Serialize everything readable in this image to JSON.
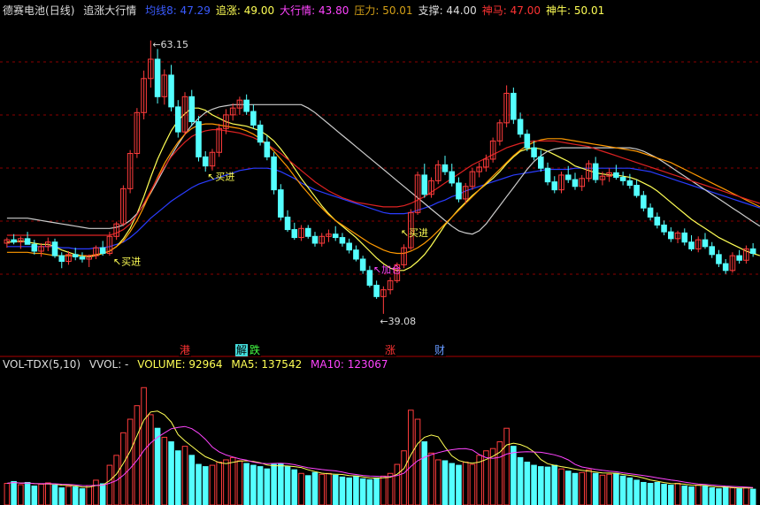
{
  "header": {
    "stock_name": "德赛电池",
    "period": "(日线)",
    "indicator_name": "追涨大行情",
    "items": [
      {
        "label": "均线8: ",
        "value": "47.29",
        "color": "#3a5bff"
      },
      {
        "label": "追涨: ",
        "value": "49.00",
        "color": "#ffff55"
      },
      {
        "label": "大行情: ",
        "value": "43.80",
        "color": "#ff44ff"
      },
      {
        "label": "压力: ",
        "value": "50.01",
        "color": "#d4a017"
      },
      {
        "label": "支撑: ",
        "value": "44.00",
        "color": "#dddddd"
      },
      {
        "label": "神马: ",
        "value": "47.00",
        "color": "#ff3333"
      },
      {
        "label": "神牛: ",
        "value": "50.01",
        "color": "#ffff55"
      }
    ]
  },
  "annotations": {
    "high_label": "63.15",
    "low_label": "39.08",
    "buy1": "买进",
    "buy2": "买进",
    "buy3": "买进",
    "add": "加仓"
  },
  "badges": [
    {
      "text": "港",
      "color": "#ff3333",
      "bg": "#000000"
    },
    {
      "text": "解",
      "color": "#000000",
      "bg": "#44dddd"
    },
    {
      "text": "跌",
      "color": "#44ff44",
      "bg": "#000000"
    },
    {
      "text": "涨",
      "color": "#ff3333",
      "bg": "#000000"
    },
    {
      "text": "财",
      "color": "#6699ff",
      "bg": "#000000"
    }
  ],
  "volume_header": {
    "name": "VOL-TDX(5,10)",
    "vvol": "VVOL: -",
    "volume_label": "VOLUME: ",
    "volume_value": "92964",
    "ma5_label": "MA5: ",
    "ma5_value": "137542",
    "ma10_label": "MA10: ",
    "ma10_value": "123067"
  },
  "colors": {
    "up": "#ff3c3c",
    "down": "#54ffff",
    "grid": "#8b0000",
    "ma_blue": "#2a3cff",
    "ma_yellow": "#ffff55",
    "ma_white": "#cccccc",
    "ma_orange": "#ff9900",
    "ma_red": "#dd2222",
    "vol_ma5": "#ffff55",
    "vol_ma10": "#ff44ff"
  },
  "chart_data": {
    "type": "candlestick",
    "price_range": [
      36.5,
      65.0
    ],
    "high": 63.15,
    "low": 39.08,
    "candles": [
      [
        45.3,
        45.8,
        44.9,
        45.6
      ],
      [
        45.6,
        46.1,
        45.2,
        45.4
      ],
      [
        45.4,
        45.9,
        44.8,
        45.7
      ],
      [
        45.7,
        46.3,
        45.3,
        45.2
      ],
      [
        45.2,
        45.6,
        44.3,
        44.6
      ],
      [
        44.6,
        45.3,
        44.1,
        45.0
      ],
      [
        45.0,
        45.8,
        44.6,
        45.4
      ],
      [
        45.4,
        45.7,
        44.0,
        44.2
      ],
      [
        44.2,
        44.5,
        43.1,
        43.7
      ],
      [
        43.7,
        44.6,
        43.4,
        44.3
      ],
      [
        44.3,
        44.9,
        43.8,
        44.1
      ],
      [
        44.1,
        44.5,
        43.6,
        43.9
      ],
      [
        43.9,
        44.3,
        43.2,
        44.2
      ],
      [
        44.2,
        45.1,
        43.9,
        44.9
      ],
      [
        44.9,
        45.5,
        44.2,
        44.4
      ],
      [
        44.4,
        46.3,
        44.2,
        45.9
      ],
      [
        45.9,
        47.2,
        45.6,
        47.0
      ],
      [
        47.0,
        50.4,
        46.8,
        50.1
      ],
      [
        50.1,
        53.5,
        49.7,
        53.2
      ],
      [
        53.2,
        57.2,
        52.8,
        56.8
      ],
      [
        56.8,
        60.5,
        56.2,
        59.8
      ],
      [
        59.8,
        63.15,
        59.0,
        61.5
      ],
      [
        61.5,
        62.4,
        57.6,
        58.2
      ],
      [
        58.2,
        60.6,
        57.5,
        60.1
      ],
      [
        60.1,
        61.0,
        56.9,
        57.3
      ],
      [
        57.3,
        57.9,
        54.6,
        55.1
      ],
      [
        55.1,
        58.6,
        54.8,
        58.2
      ],
      [
        58.2,
        58.8,
        55.6,
        56.0
      ],
      [
        56.0,
        56.5,
        52.5,
        52.9
      ],
      [
        52.9,
        53.4,
        51.6,
        52.1
      ],
      [
        52.1,
        53.6,
        51.7,
        53.3
      ],
      [
        53.3,
        55.8,
        52.9,
        55.4
      ],
      [
        55.4,
        57.1,
        54.9,
        56.6
      ],
      [
        56.6,
        57.6,
        56.1,
        57.2
      ],
      [
        57.2,
        58.2,
        56.6,
        57.9
      ],
      [
        57.9,
        58.4,
        56.6,
        56.9
      ],
      [
        56.9,
        57.5,
        55.4,
        55.7
      ],
      [
        55.7,
        56.1,
        53.9,
        54.2
      ],
      [
        54.2,
        54.8,
        52.6,
        52.9
      ],
      [
        52.9,
        53.3,
        49.6,
        50.0
      ],
      [
        50.0,
        50.5,
        47.3,
        47.6
      ],
      [
        47.6,
        48.2,
        46.3,
        46.5
      ],
      [
        46.5,
        47.1,
        45.6,
        45.8
      ],
      [
        45.8,
        46.9,
        45.5,
        46.6
      ],
      [
        46.6,
        46.9,
        45.7,
        45.9
      ],
      [
        45.9,
        46.3,
        45.0,
        45.3
      ],
      [
        45.3,
        46.2,
        45.0,
        45.9
      ],
      [
        45.9,
        46.5,
        45.4,
        46.1
      ],
      [
        46.1,
        46.8,
        45.5,
        45.8
      ],
      [
        45.8,
        46.2,
        45.0,
        45.3
      ],
      [
        45.3,
        45.7,
        44.4,
        44.7
      ],
      [
        44.7,
        45.1,
        43.7,
        43.9
      ],
      [
        43.9,
        44.2,
        42.6,
        42.9
      ],
      [
        42.9,
        43.3,
        41.4,
        41.6
      ],
      [
        41.6,
        42.0,
        40.4,
        40.6
      ],
      [
        40.6,
        41.5,
        39.08,
        41.2
      ],
      [
        41.2,
        42.3,
        40.8,
        42.0
      ],
      [
        42.0,
        43.6,
        41.8,
        43.4
      ],
      [
        43.4,
        45.2,
        43.1,
        44.9
      ],
      [
        44.9,
        48.3,
        44.7,
        48.0
      ],
      [
        48.0,
        51.6,
        47.8,
        51.3
      ],
      [
        51.3,
        52.3,
        49.3,
        49.6
      ],
      [
        49.6,
        51.1,
        49.3,
        50.8
      ],
      [
        50.8,
        52.6,
        50.5,
        52.2
      ],
      [
        52.2,
        53.0,
        51.3,
        51.6
      ],
      [
        51.6,
        52.3,
        50.3,
        50.6
      ],
      [
        50.6,
        51.1,
        48.9,
        49.2
      ],
      [
        49.2,
        50.6,
        48.8,
        50.3
      ],
      [
        50.3,
        51.9,
        50.0,
        51.6
      ],
      [
        51.6,
        52.4,
        51.1,
        52.0
      ],
      [
        52.0,
        53.1,
        51.6,
        52.7
      ],
      [
        52.7,
        54.6,
        52.4,
        54.3
      ],
      [
        54.3,
        56.2,
        53.9,
        55.9
      ],
      [
        55.9,
        59.2,
        55.5,
        58.5
      ],
      [
        58.5,
        59.0,
        55.8,
        56.2
      ],
      [
        56.2,
        56.8,
        54.6,
        54.9
      ],
      [
        54.9,
        55.3,
        53.4,
        53.7
      ],
      [
        53.7,
        54.3,
        52.6,
        52.9
      ],
      [
        52.9,
        53.5,
        51.6,
        51.9
      ],
      [
        51.9,
        52.4,
        50.4,
        50.7
      ],
      [
        50.7,
        51.2,
        49.7,
        50.0
      ],
      [
        50.0,
        51.6,
        49.7,
        51.3
      ],
      [
        51.3,
        52.1,
        50.6,
        50.9
      ],
      [
        50.9,
        51.5,
        50.0,
        50.3
      ],
      [
        50.3,
        51.3,
        49.9,
        51.0
      ],
      [
        51.0,
        52.6,
        50.7,
        52.3
      ],
      [
        52.3,
        52.9,
        50.6,
        50.9
      ],
      [
        50.9,
        51.6,
        50.4,
        51.2
      ],
      [
        51.2,
        51.9,
        50.7,
        51.5
      ],
      [
        51.5,
        52.2,
        50.9,
        51.1
      ],
      [
        51.1,
        51.6,
        50.4,
        50.8
      ],
      [
        50.8,
        51.4,
        50.1,
        50.4
      ],
      [
        50.4,
        50.9,
        49.3,
        49.5
      ],
      [
        49.5,
        49.9,
        48.1,
        48.4
      ],
      [
        48.4,
        48.8,
        47.3,
        47.6
      ],
      [
        47.6,
        48.0,
        46.6,
        46.9
      ],
      [
        46.9,
        47.3,
        46.0,
        46.3
      ],
      [
        46.3,
        46.7,
        45.4,
        45.7
      ],
      [
        45.7,
        46.4,
        45.3,
        46.2
      ],
      [
        46.2,
        46.6,
        45.1,
        45.4
      ],
      [
        45.4,
        46.0,
        44.6,
        44.8
      ],
      [
        44.8,
        45.9,
        44.5,
        45.6
      ],
      [
        45.6,
        46.2,
        44.8,
        45.0
      ],
      [
        45.0,
        45.4,
        44.0,
        44.3
      ],
      [
        44.3,
        44.7,
        43.2,
        43.5
      ],
      [
        43.5,
        43.9,
        42.6,
        42.9
      ],
      [
        42.9,
        44.5,
        42.7,
        44.2
      ],
      [
        44.2,
        44.7,
        43.5,
        43.8
      ],
      [
        43.8,
        45.1,
        43.5,
        44.8
      ],
      [
        44.8,
        45.3,
        44.1,
        44.4
      ]
    ],
    "volumes": [
      48,
      52,
      45,
      50,
      42,
      46,
      49,
      44,
      38,
      41,
      40,
      36,
      43,
      55,
      47,
      88,
      110,
      160,
      190,
      220,
      260,
      200,
      170,
      150,
      140,
      120,
      130,
      110,
      90,
      85,
      88,
      95,
      100,
      105,
      98,
      92,
      88,
      85,
      80,
      90,
      92,
      85,
      78,
      70,
      65,
      72,
      68,
      70,
      66,
      62,
      60,
      64,
      58,
      56,
      60,
      64,
      70,
      90,
      120,
      210,
      190,
      140,
      115,
      100,
      98,
      92,
      88,
      95,
      90,
      110,
      120,
      125,
      140,
      170,
      130,
      105,
      95,
      88,
      85,
      84,
      88,
      80,
      75,
      70,
      72,
      78,
      70,
      66,
      68,
      70,
      64,
      60,
      55,
      50,
      48,
      50,
      46,
      44,
      48,
      42,
      40,
      44,
      42,
      38,
      36,
      40,
      38,
      36,
      39,
      35
    ],
    "ma_lines": {
      "blue_ma": [
        45.0,
        45.0,
        45.0,
        45.0,
        45.0,
        45.0,
        45.0,
        45.0,
        44.9,
        44.9,
        44.8,
        44.8,
        44.8,
        44.9,
        44.9,
        45.0,
        45.2,
        45.4,
        45.8,
        46.3,
        46.9,
        47.5,
        48.0,
        48.5,
        49.0,
        49.4,
        49.8,
        50.2,
        50.5,
        50.7,
        50.9,
        51.1,
        51.3,
        51.5,
        51.7,
        51.8,
        51.9,
        51.9,
        51.9,
        51.8,
        51.6,
        51.3,
        51.0,
        50.6,
        50.3,
        50.0,
        49.8,
        49.6,
        49.4,
        49.2,
        49.0,
        48.8,
        48.6,
        48.4,
        48.2,
        48.0,
        47.9,
        47.9,
        47.9,
        48.0,
        48.2,
        48.4,
        48.6,
        48.9,
        49.1,
        49.4,
        49.6,
        49.9,
        50.1,
        50.3,
        50.5,
        50.7,
        50.9,
        51.1,
        51.3,
        51.4,
        51.5,
        51.6,
        51.7,
        51.8,
        51.8,
        51.8,
        51.8,
        51.9,
        51.9,
        51.9,
        51.9,
        51.9,
        51.9,
        51.9,
        51.9,
        51.9,
        51.8,
        51.7,
        51.6,
        51.4,
        51.2,
        51.0,
        50.8,
        50.6,
        50.4,
        50.2,
        50.0,
        49.8,
        49.6,
        49.4,
        49.2,
        49.0,
        48.8,
        48.6,
        48.4
      ],
      "yellow_ma": [
        45.4,
        45.4,
        45.5,
        45.4,
        45.3,
        45.2,
        45.2,
        45.0,
        44.7,
        44.5,
        44.3,
        44.2,
        44.1,
        44.2,
        44.4,
        44.6,
        45.0,
        45.7,
        46.6,
        47.9,
        49.4,
        51.1,
        52.7,
        54.0,
        55.2,
        56.1,
        56.7,
        57.2,
        57.2,
        57.0,
        56.6,
        56.3,
        56.0,
        55.8,
        55.7,
        55.6,
        55.4,
        55.2,
        54.8,
        54.3,
        53.6,
        52.8,
        51.9,
        51.0,
        50.2,
        49.4,
        48.6,
        47.9,
        47.3,
        46.8,
        46.3,
        45.8,
        45.2,
        44.6,
        44.0,
        43.5,
        43.1,
        42.9,
        42.9,
        43.2,
        43.7,
        44.3,
        45.1,
        46.0,
        46.9,
        47.6,
        48.3,
        48.9,
        49.5,
        50.0,
        50.5,
        51.0,
        51.6,
        52.3,
        52.9,
        53.4,
        53.6,
        53.7,
        53.6,
        53.4,
        53.1,
        52.8,
        52.5,
        52.1,
        51.9,
        51.7,
        51.5,
        51.4,
        51.3,
        51.3,
        51.2,
        51.1,
        50.9,
        50.6,
        50.3,
        49.9,
        49.4,
        48.9,
        48.4,
        47.9,
        47.4,
        47.0,
        46.6,
        46.2,
        45.8,
        45.5,
        45.2,
        44.9,
        44.6,
        44.4,
        44.2
      ],
      "white_ma": [
        47.5,
        47.5,
        47.5,
        47.5,
        47.4,
        47.3,
        47.2,
        47.1,
        47.0,
        46.9,
        46.8,
        46.7,
        46.6,
        46.6,
        46.6,
        46.6,
        46.7,
        46.9,
        47.3,
        47.9,
        48.7,
        49.7,
        50.8,
        51.9,
        53.0,
        54.0,
        54.9,
        55.7,
        56.3,
        56.8,
        57.1,
        57.3,
        57.4,
        57.5,
        57.5,
        57.5,
        57.5,
        57.5,
        57.5,
        57.5,
        57.5,
        57.5,
        57.5,
        57.5,
        57.2,
        56.8,
        56.3,
        55.8,
        55.3,
        54.8,
        54.3,
        53.8,
        53.3,
        52.8,
        52.3,
        51.8,
        51.3,
        50.8,
        50.3,
        49.8,
        49.3,
        48.8,
        48.3,
        47.8,
        47.3,
        46.8,
        46.4,
        46.2,
        46.1,
        46.4,
        47.0,
        47.8,
        48.6,
        49.4,
        50.2,
        51.0,
        51.8,
        52.5,
        53.0,
        53.4,
        53.6,
        53.7,
        53.7,
        53.7,
        53.7,
        53.7,
        53.7,
        53.7,
        53.7,
        53.7,
        53.7,
        53.7,
        53.6,
        53.4,
        53.1,
        52.8,
        52.4,
        52.0,
        51.6,
        51.2,
        50.8,
        50.4,
        50.0,
        49.6,
        49.2,
        48.8,
        48.4,
        48.0,
        47.6,
        47.2,
        46.8
      ],
      "orange_ma": [
        44.5,
        44.5,
        44.5,
        44.5,
        44.4,
        44.4,
        44.3,
        44.2,
        44.2,
        44.2,
        44.2,
        44.2,
        44.2,
        44.3,
        44.4,
        44.6,
        45.0,
        45.5,
        46.3,
        47.3,
        48.5,
        49.8,
        51.1,
        52.3,
        53.3,
        54.2,
        54.9,
        55.4,
        55.7,
        55.8,
        55.8,
        55.7,
        55.6,
        55.5,
        55.4,
        55.2,
        54.9,
        54.5,
        54.0,
        53.4,
        52.7,
        52.0,
        51.2,
        50.4,
        49.7,
        49.0,
        48.4,
        47.8,
        47.3,
        46.9,
        46.5,
        46.1,
        45.7,
        45.3,
        45.0,
        44.7,
        44.5,
        44.4,
        44.4,
        44.6,
        44.9,
        45.3,
        45.8,
        46.4,
        47.0,
        47.6,
        48.2,
        48.8,
        49.4,
        50.0,
        50.6,
        51.2,
        51.8,
        52.4,
        53.0,
        53.5,
        53.9,
        54.2,
        54.4,
        54.5,
        54.5,
        54.5,
        54.4,
        54.3,
        54.2,
        54.1,
        54.0,
        53.9,
        53.8,
        53.7,
        53.6,
        53.5,
        53.4,
        53.2,
        53.0,
        52.8,
        52.6,
        52.4,
        52.1,
        51.8,
        51.5,
        51.2,
        50.9,
        50.6,
        50.3,
        50.0,
        49.7,
        49.4,
        49.1,
        48.8,
        48.5
      ],
      "red_ma": [
        46.0,
        46.0,
        46.0,
        46.0,
        46.0,
        46.0,
        46.0,
        46.0,
        46.0,
        46.0,
        46.0,
        46.0,
        46.0,
        46.0,
        46.0,
        46.0,
        46.2,
        46.5,
        47.0,
        47.8,
        48.8,
        49.9,
        51.0,
        52.0,
        52.9,
        53.6,
        54.2,
        54.7,
        55.0,
        55.2,
        55.3,
        55.3,
        55.2,
        55.1,
        55.0,
        54.8,
        54.6,
        54.3,
        54.0,
        53.6,
        53.2,
        52.7,
        52.2,
        51.7,
        51.2,
        50.7,
        50.3,
        49.9,
        49.6,
        49.3,
        49.1,
        48.9,
        48.8,
        48.7,
        48.6,
        48.5,
        48.5,
        48.5,
        48.6,
        48.8,
        49.1,
        49.4,
        49.8,
        50.2,
        50.6,
        51.0,
        51.4,
        51.8,
        52.2,
        52.5,
        52.8,
        53.1,
        53.4,
        53.7,
        53.9,
        54.1,
        54.2,
        54.3,
        54.3,
        54.3,
        54.3,
        54.2,
        54.1,
        54.0,
        53.9,
        53.8,
        53.6,
        53.4,
        53.2,
        53.0,
        52.8,
        52.6,
        52.4,
        52.2,
        52.0,
        51.8,
        51.6,
        51.4,
        51.2,
        51.0,
        50.8,
        50.6,
        50.4,
        50.2,
        50.0,
        49.8,
        49.6,
        49.4,
        49.2,
        49.0,
        48.8
      ]
    }
  }
}
